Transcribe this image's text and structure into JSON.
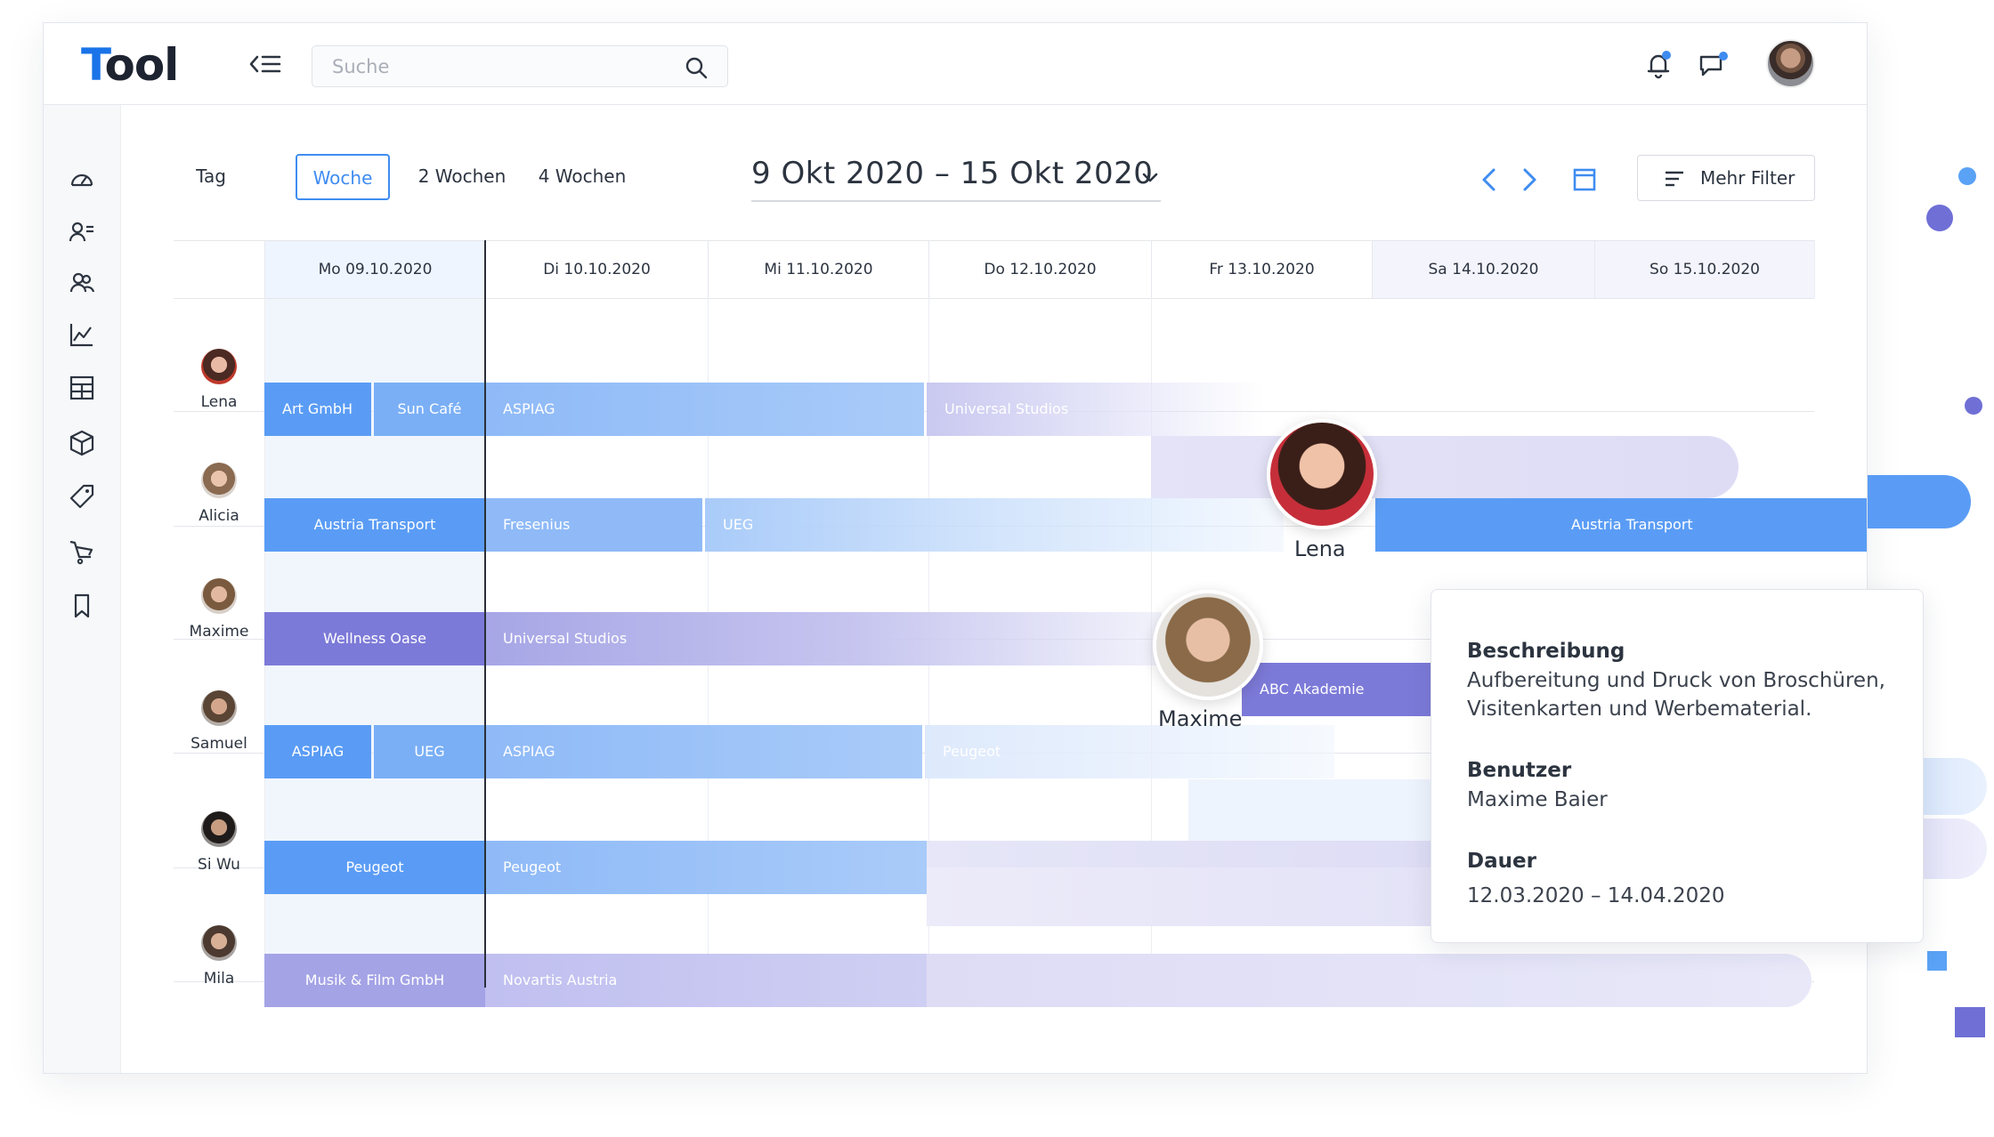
{
  "app": {
    "logo_first": "T",
    "logo_rest": "ool"
  },
  "search": {
    "placeholder": "Suche"
  },
  "view_tabs": [
    {
      "label": "Tag",
      "active": false
    },
    {
      "label": "Woche",
      "active": true
    },
    {
      "label": "2 Wochen",
      "active": false
    },
    {
      "label": "4 Wochen",
      "active": false
    }
  ],
  "date_range": "9 Okt 2020 – 15 Okt 2020",
  "filter_button": "Mehr Filter",
  "days": [
    "Mo 09.10.2020",
    "Di 10.10.2020",
    "Mi 11.10.2020",
    "Do 12.10.2020",
    "Fr 13.10.2020",
    "Sa 14.10.2020",
    "So 15.10.2020"
  ],
  "people": [
    "Lena",
    "Alicia",
    "Maxime",
    "Samuel",
    "Si Wu",
    "Mila"
  ],
  "bars": {
    "lena_1": "Art GmbH",
    "lena_2": "Sun Café",
    "lena_3": "ASPIAG",
    "lena_4": "Universal Studios",
    "alicia_1": "Austria Transport",
    "alicia_2": "Fresenius",
    "alicia_3": "UEG",
    "alicia_4": "Austria Transport",
    "maxime_1": "Wellness Oase",
    "maxime_2": "Universal Studios",
    "maxime_3": "ABC Akademie",
    "samuel_1": "ASPIAG",
    "samuel_2": "UEG",
    "samuel_3": "ASPIAG",
    "samuel_4": "Peugeot",
    "siwu_1": "Peugeot",
    "siwu_2": "Peugeot",
    "mila_1": "Musik & Film GmbH",
    "mila_2": "Novartis Austria"
  },
  "float_profiles": {
    "lena": "Lena",
    "maxime": "Maxime"
  },
  "tooltip": {
    "desc_label": "Beschreibung",
    "desc_value": "Aufbereitung und Druck von Broschüren, Visitenkarten und Werbematerial.",
    "user_label": "Benutzer",
    "user_value": "Maxime Baier",
    "duration_label": "Dauer",
    "duration_value": "12.03.2020 – 14.04.2020"
  },
  "colors": {
    "accent": "#3f8cf0",
    "blue_bar": "#5a9cf5",
    "purple_bar": "#7c7ad8",
    "notification_dot": "#3f8cf0"
  }
}
